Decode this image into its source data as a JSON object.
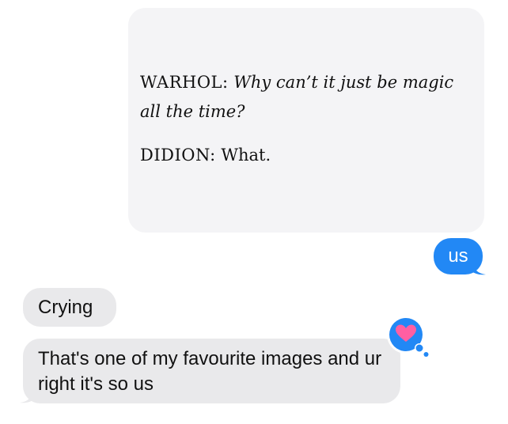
{
  "shared_image": {
    "speaker1": "WARHOL:",
    "line1_text": "Why can’t it just be magic all the time?",
    "speaker2": "DIDION:",
    "line2_text": "What."
  },
  "messages": [
    {
      "direction": "outgoing",
      "text": "us"
    },
    {
      "direction": "incoming",
      "text": "Crying"
    },
    {
      "direction": "incoming",
      "text": "That's one of my favourite images and ur right it's so us"
    }
  ],
  "reaction": {
    "icon": "heart-icon",
    "color": "#ff5fa2",
    "badge_color": "#2288f5"
  },
  "colors": {
    "outgoing_bubble": "#2288f5",
    "incoming_bubble": "#e9e9eb",
    "image_background": "#f4f4f6"
  }
}
